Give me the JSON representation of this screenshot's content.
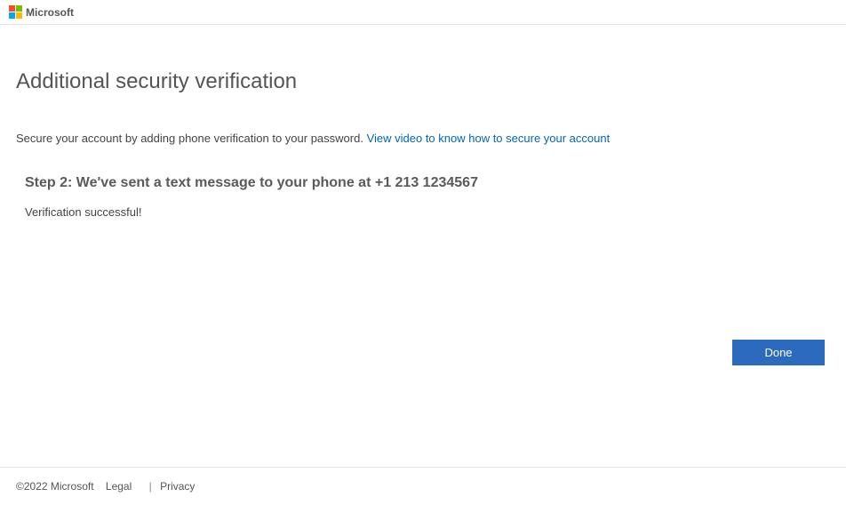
{
  "header": {
    "brand": "Microsoft"
  },
  "main": {
    "title": "Additional security verification",
    "description_prefix": "Secure your account by adding phone verification to your password. ",
    "video_link": "View video to know how to secure your account",
    "step_heading": "Step 2: We've sent a text message to your phone at +1 213 1234567",
    "status": "Verification successful!",
    "done_label": "Done"
  },
  "footer": {
    "copyright": "©2022 Microsoft",
    "legal": "Legal",
    "privacy": "Privacy"
  }
}
